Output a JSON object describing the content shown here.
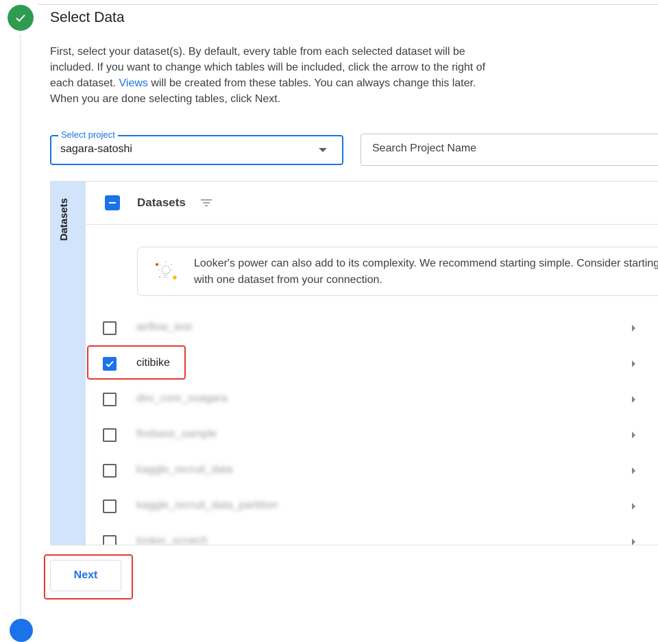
{
  "step": {
    "title": "Select Data",
    "description": {
      "before_link": "First, select your dataset(s). By default, every table from each selected dataset will be included. If you want to change which tables will be included, click the arrow to the right of each dataset. ",
      "link": "Views",
      "after_link": " will be created from these tables. You can always change this later. When you are done selecting tables, click Next."
    }
  },
  "project_select": {
    "label": "Select project",
    "value": "sagara-satoshi"
  },
  "search": {
    "placeholder": "Search Project Name"
  },
  "panel": {
    "side_tab": "Datasets",
    "header": "Datasets",
    "tip": "Looker's power can also add to its complexity. We recommend starting simple. Consider starting with one dataset from your connection."
  },
  "datasets": [
    {
      "label": "airflow_test",
      "checked": false,
      "blurred": true
    },
    {
      "label": "citibike",
      "checked": true,
      "blurred": false
    },
    {
      "label": "dev_core_osagara",
      "checked": false,
      "blurred": true
    },
    {
      "label": "firebase_sample",
      "checked": false,
      "blurred": true
    },
    {
      "label": "kaggle_recruit_data",
      "checked": false,
      "blurred": true
    },
    {
      "label": "kaggle_recruit_data_partition",
      "checked": false,
      "blurred": true
    },
    {
      "label": "looker_scratch",
      "checked": false,
      "blurred": true
    }
  ],
  "actions": {
    "next": "Next"
  },
  "colors": {
    "accent": "#1a73e8",
    "success": "#2e9b4f",
    "highlight": "#e53935",
    "side_tab": "#d2e3fc"
  }
}
